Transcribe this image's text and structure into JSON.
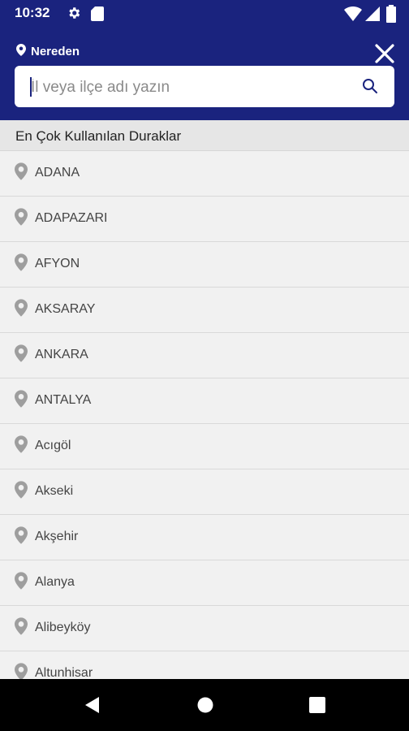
{
  "status_bar": {
    "time": "10:32"
  },
  "header": {
    "from_label": "Nereden",
    "search": {
      "placeholder": "İl veya ilçe adı yazın",
      "value": ""
    }
  },
  "section": {
    "title": "En Çok Kullanılan Duraklar"
  },
  "stops": [
    "ADANA",
    "ADAPAZARI",
    "AFYON",
    "AKSARAY",
    "ANKARA",
    "ANTALYA",
    "Acıgöl",
    "Akseki",
    "Akşehir",
    "Alanya",
    "Alibeyköy",
    "Altunhisar"
  ],
  "colors": {
    "primary": "#1a237e",
    "pin": "#9e9e9e"
  },
  "icons": {
    "status": [
      "gear-icon",
      "sd-card-icon",
      "wifi-icon",
      "signal-icon",
      "battery-icon"
    ],
    "header": [
      "location-pin-icon",
      "close-icon",
      "search-icon"
    ],
    "list": "location-pin-icon",
    "navigation": [
      "back-icon",
      "home-icon",
      "recents-icon"
    ]
  }
}
